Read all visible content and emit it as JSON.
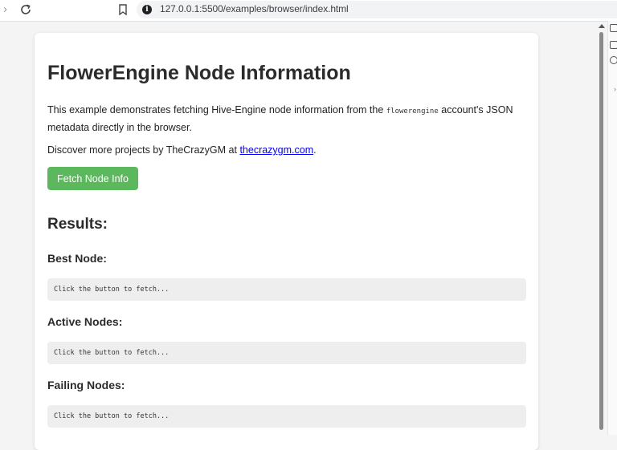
{
  "browser": {
    "url": "127.0.0.1:5500/examples/browser/index.html"
  },
  "page": {
    "title": "FlowerEngine Node Information",
    "description_before": "This example demonstrates fetching Hive-Engine node information from the ",
    "description_code": "flowerengine",
    "description_after": " account's JSON metadata directly in the browser.",
    "discover_before": "Discover more projects by TheCrazyGM at ",
    "discover_link": "thecrazygm.com",
    "discover_after": ".",
    "fetch_button": "Fetch Node Info",
    "results_heading": "Results:",
    "sections": [
      {
        "heading": "Best Node:",
        "output": "Click the button to fetch..."
      },
      {
        "heading": "Active Nodes:",
        "output": "Click the button to fetch..."
      },
      {
        "heading": "Failing Nodes:",
        "output": "Click the button to fetch..."
      }
    ]
  },
  "colors": {
    "button": "#5cb85c",
    "link": "#0000ee"
  }
}
